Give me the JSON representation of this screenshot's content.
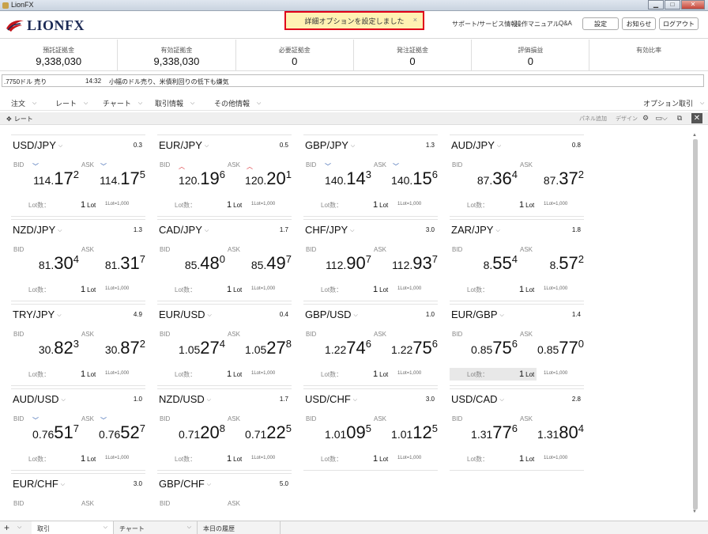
{
  "window": {
    "title": "LionFX"
  },
  "header": {
    "logo_text": "LIONFX",
    "toast": "詳細オプションを設定しました",
    "toast_close": "×",
    "links": [
      "サポート/サービス情報",
      "操作マニュアル",
      "Q&A"
    ],
    "buttons": [
      "設定",
      "お知らせ",
      "ログアウト"
    ]
  },
  "summary": [
    {
      "label": "預託証拠金",
      "value": "9,338,030"
    },
    {
      "label": "有効証拠金",
      "value": "9,338,030"
    },
    {
      "label": "必要証拠金",
      "value": "0"
    },
    {
      "label": "発注証拠金",
      "value": "0"
    },
    {
      "label": "評価損益",
      "value": "0"
    },
    {
      "label": "有効比率",
      "value": ""
    }
  ],
  "ticker": {
    "prev": ".7750ドル 売り",
    "time": "14:32",
    "text": "小幅のドル売り、米債利回りの低下も嫌気"
  },
  "menu": {
    "items": [
      "注文",
      "レート",
      "チャート",
      "取引情報",
      "その他情報"
    ],
    "option_label": "オプション取引"
  },
  "panel": {
    "title": "レート",
    "panel_add": "パネル追加",
    "design": "デザイン",
    "close": "✕"
  },
  "labels": {
    "bid": "BID",
    "ask": "ASK",
    "lot": "Lot数：",
    "lot_value": "1",
    "lot_word": "Lot",
    "lot_unit": "1Lot=1,000"
  },
  "rates": [
    {
      "pair": "USD/JPY",
      "spread": "0.3",
      "bid": [
        "114.",
        "17",
        "2"
      ],
      "ask": [
        "114.",
        "17",
        "5"
      ],
      "arrow": "down"
    },
    {
      "pair": "EUR/JPY",
      "spread": "0.5",
      "bid": [
        "120.",
        "19",
        "6"
      ],
      "ask": [
        "120.",
        "20",
        "1"
      ],
      "arrow": "up"
    },
    {
      "pair": "GBP/JPY",
      "spread": "1.3",
      "bid": [
        "140.",
        "14",
        "3"
      ],
      "ask": [
        "140.",
        "15",
        "6"
      ],
      "arrow": "down"
    },
    {
      "pair": "AUD/JPY",
      "spread": "0.8",
      "bid": [
        "87.",
        "36",
        "4"
      ],
      "ask": [
        "87.",
        "37",
        "2"
      ],
      "arrow": ""
    },
    {
      "pair": "NZD/JPY",
      "spread": "1.3",
      "bid": [
        "81.",
        "30",
        "4"
      ],
      "ask": [
        "81.",
        "31",
        "7"
      ],
      "arrow": ""
    },
    {
      "pair": "CAD/JPY",
      "spread": "1.7",
      "bid": [
        "85.",
        "48",
        "0"
      ],
      "ask": [
        "85.",
        "49",
        "7"
      ],
      "arrow": ""
    },
    {
      "pair": "CHF/JPY",
      "spread": "3.0",
      "bid": [
        "112.",
        "90",
        "7"
      ],
      "ask": [
        "112.",
        "93",
        "7"
      ],
      "arrow": ""
    },
    {
      "pair": "ZAR/JPY",
      "spread": "1.8",
      "bid": [
        "8.",
        "55",
        "4"
      ],
      "ask": [
        "8.",
        "57",
        "2"
      ],
      "arrow": ""
    },
    {
      "pair": "TRY/JPY",
      "spread": "4.9",
      "bid": [
        "30.",
        "82",
        "3"
      ],
      "ask": [
        "30.",
        "87",
        "2"
      ],
      "arrow": ""
    },
    {
      "pair": "EUR/USD",
      "spread": "0.4",
      "bid": [
        "1.05",
        "27",
        "4"
      ],
      "ask": [
        "1.05",
        "27",
        "8"
      ],
      "arrow": ""
    },
    {
      "pair": "GBP/USD",
      "spread": "1.0",
      "bid": [
        "1.22",
        "74",
        "6"
      ],
      "ask": [
        "1.22",
        "75",
        "6"
      ],
      "arrow": ""
    },
    {
      "pair": "EUR/GBP",
      "spread": "1.4",
      "bid": [
        "0.85",
        "75",
        "6"
      ],
      "ask": [
        "0.85",
        "77",
        "0"
      ],
      "arrow": "",
      "highlight": true
    },
    {
      "pair": "AUD/USD",
      "spread": "1.0",
      "bid": [
        "0.76",
        "51",
        "7"
      ],
      "ask": [
        "0.76",
        "52",
        "7"
      ],
      "arrow": "down"
    },
    {
      "pair": "NZD/USD",
      "spread": "1.7",
      "bid": [
        "0.71",
        "20",
        "8"
      ],
      "ask": [
        "0.71",
        "22",
        "5"
      ],
      "arrow": ""
    },
    {
      "pair": "USD/CHF",
      "spread": "3.0",
      "bid": [
        "1.01",
        "09",
        "5"
      ],
      "ask": [
        "1.01",
        "12",
        "5"
      ],
      "arrow": ""
    },
    {
      "pair": "USD/CAD",
      "spread": "2.8",
      "bid": [
        "1.31",
        "77",
        "6"
      ],
      "ask": [
        "1.31",
        "80",
        "4"
      ],
      "arrow": ""
    },
    {
      "pair": "EUR/CHF",
      "spread": "3.0",
      "bid": [
        "",
        "",
        ""
      ],
      "ask": [
        "",
        "",
        ""
      ],
      "arrow": ""
    },
    {
      "pair": "GBP/CHF",
      "spread": "5.0",
      "bid": [
        "",
        "",
        ""
      ],
      "ask": [
        "",
        "",
        ""
      ],
      "arrow": ""
    }
  ],
  "bottom_tabs": [
    "取引",
    "チャート",
    "本日の履歴"
  ]
}
